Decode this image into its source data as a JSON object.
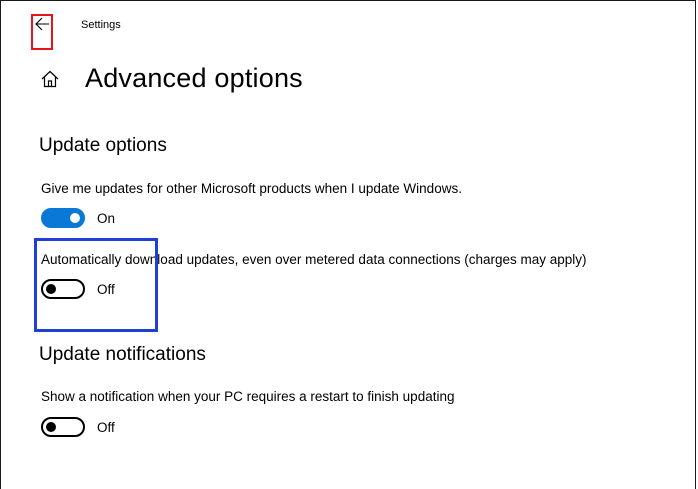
{
  "window": {
    "title": "Settings",
    "back_icon": "arrow-left-icon"
  },
  "header": {
    "home_icon": "home-icon",
    "title": "Advanced options"
  },
  "update_options": {
    "title": "Update options",
    "microsoft_products": {
      "description": "Give me updates for other Microsoft products when I update Windows.",
      "state": "On",
      "enabled": true
    },
    "metered_download": {
      "description": "Automatically download updates, even over metered data connections (charges may apply)",
      "state": "Off",
      "enabled": false
    }
  },
  "update_notifications": {
    "title": "Update notifications",
    "restart_notification": {
      "description": "Show a notification when your PC requires a restart to finish updating",
      "state": "Off",
      "enabled": false
    }
  },
  "colors": {
    "accent": "#0a78d7",
    "back_highlight": "#e8141a",
    "focus_highlight": "#1f3fd6"
  }
}
